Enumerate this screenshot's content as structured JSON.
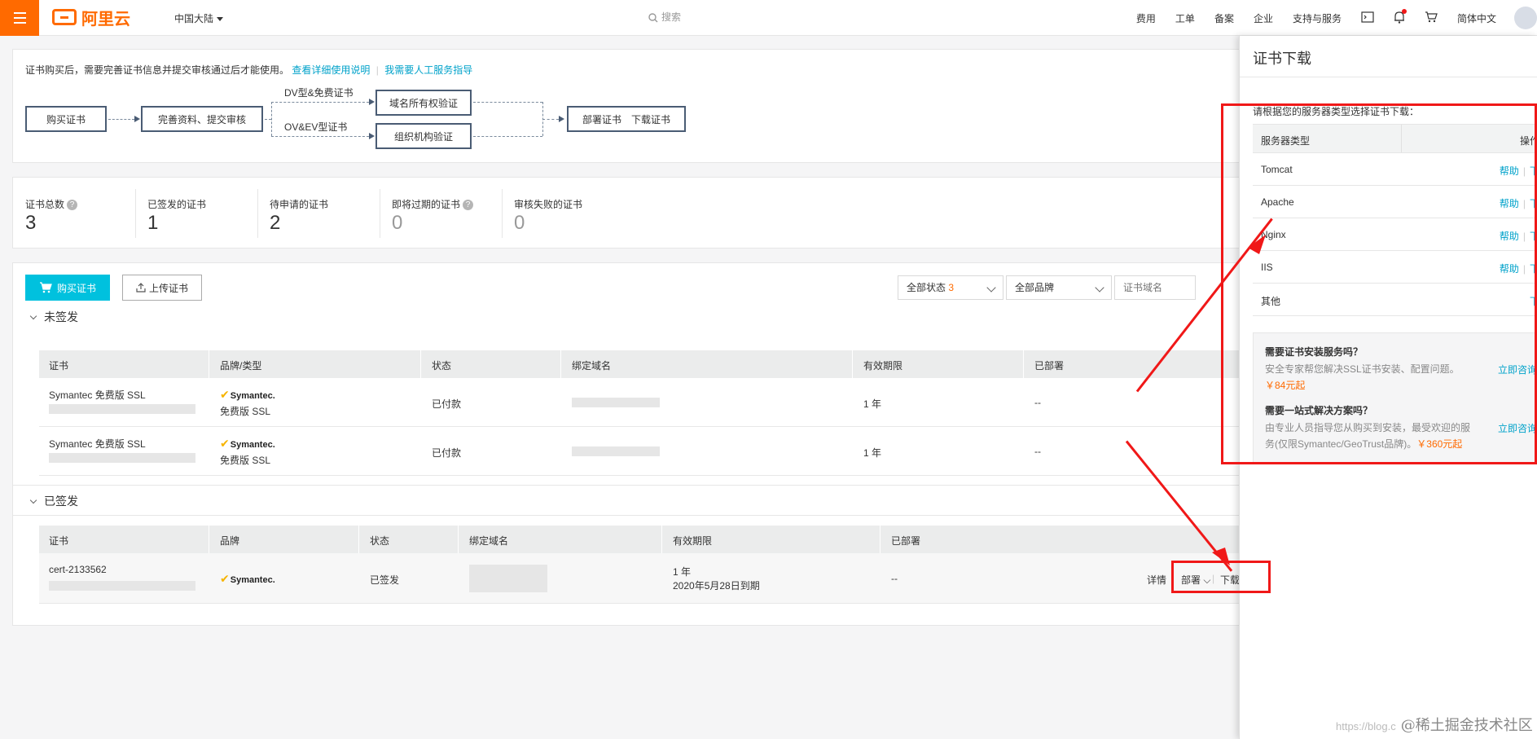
{
  "topbar": {
    "logo_text": "阿里云",
    "region": "中国大陆",
    "search_placeholder": "搜索",
    "nav": [
      "费用",
      "工单",
      "备案",
      "企业",
      "支持与服务"
    ],
    "language": "简体中文"
  },
  "intro": {
    "text": "证书购买后，需要完善证书信息并提交审核通过后才能使用。",
    "link1": "查看详细使用说明",
    "link2": "我需要人工服务指导"
  },
  "flow": {
    "buy": "购买证书",
    "complete": "完善资料、提交审核",
    "dv_label": "DV型&免费证书",
    "ov_label": "OV&EV型证书",
    "domain_verify": "域名所有权验证",
    "org_verify": "组织机构验证",
    "deploy": "部署证书",
    "download": "下载证书"
  },
  "stats": [
    {
      "label": "证书总数",
      "value": "3"
    },
    {
      "label": "已签发的证书",
      "value": "1"
    },
    {
      "label": "待申请的证书",
      "value": "2"
    },
    {
      "label": "即将过期的证书",
      "value": "0"
    },
    {
      "label": "审核失败的证书",
      "value": "0"
    }
  ],
  "toolbar": {
    "buy_button": "购买证书",
    "upload_button": "上传证书",
    "status_filter": "全部状态",
    "status_count": "3",
    "brand_filter": "全部品牌",
    "domain_placeholder": "证书域名"
  },
  "unsigned": {
    "title": "未签发",
    "headers": [
      "证书",
      "品牌/类型",
      "状态",
      "绑定域名",
      "有效期限",
      "已部署"
    ],
    "rows": [
      {
        "name": "Symantec 免费版 SSL",
        "brand": "Symantec.",
        "type": "免费版 SSL",
        "status": "已付款",
        "period": "1 年",
        "deployed": "--"
      },
      {
        "name": "Symantec 免费版 SSL",
        "brand": "Symantec.",
        "type": "免费版 SSL",
        "status": "已付款",
        "period": "1 年",
        "deployed": "--"
      }
    ]
  },
  "signed": {
    "title": "已签发",
    "headers": [
      "证书",
      "品牌",
      "状态",
      "绑定域名",
      "有效期限",
      "已部署"
    ],
    "rows": [
      {
        "name": "cert-2133562",
        "brand": "Symantec.",
        "status": "已签发",
        "period": "1 年",
        "expiry": "2020年5月28日到期",
        "deployed": "--",
        "detail": "详情",
        "deploy": "部署",
        "download": "下载"
      }
    ]
  },
  "panel": {
    "title": "证书下载",
    "hint": "请根据您的服务器类型选择证书下载：",
    "col_server": "服务器类型",
    "col_action": "操作",
    "help": "帮助",
    "download": "下载",
    "servers": [
      "Tomcat",
      "Apache",
      "Nginx",
      "IIS",
      "其他"
    ],
    "promo1_title": "需要证书安装服务吗？",
    "promo1_text": "安全专家帮您解决SSL证书安装、配置问题。",
    "promo1_price": "￥84元起",
    "promo1_link": "立即咨询",
    "promo2_title": "需要一站式解决方案吗？",
    "promo2_text": "由专业人员指导您从购买到安装，最受欢迎的服务(仅限Symantec/GeoTrust品牌)。",
    "promo2_price": "￥360元起",
    "promo2_link": "立即咨询"
  },
  "watermark": {
    "url": "https://blog.c",
    "text": "@稀土掘金技术社区"
  },
  "colors": {
    "brand": "#ff6a00",
    "primary": "#00c1de",
    "link": "#00a2ca",
    "annotation": "#f01818"
  }
}
